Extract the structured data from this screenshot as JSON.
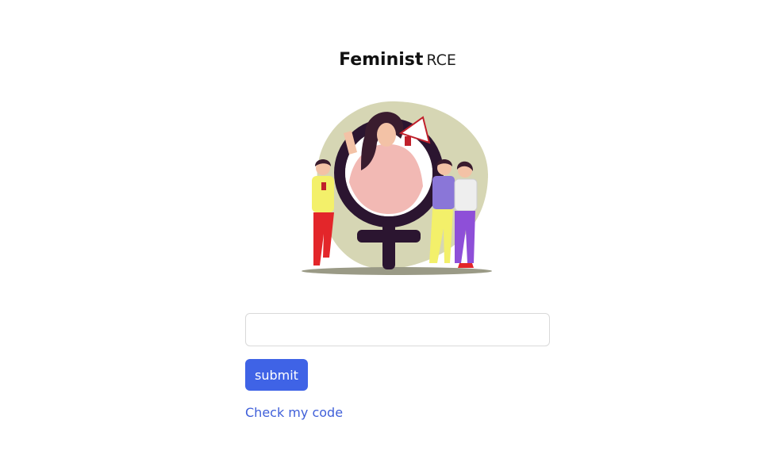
{
  "header": {
    "title_bold": "Feminist",
    "title_light": "RCE"
  },
  "hero": {
    "illustration": "feminism-rally-illustration",
    "accent_color": "#d6d6b4",
    "symbol_color": "#2b1530"
  },
  "form": {
    "input_value": "",
    "input_placeholder": "",
    "submit_label": "submit",
    "submit_color": "#3f63e6"
  },
  "footer": {
    "check_code_label": "Check my code",
    "link_color": "#3f5fd9"
  }
}
